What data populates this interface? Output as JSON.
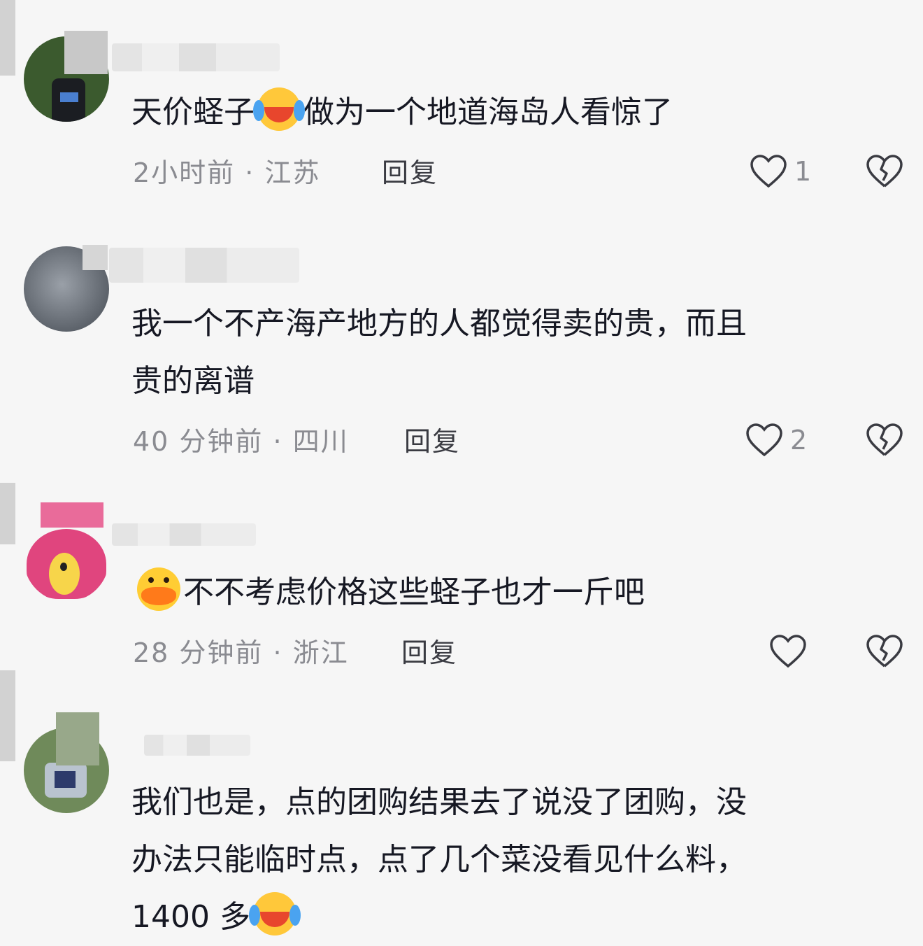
{
  "comments": [
    {
      "text_before": "天价蛏子",
      "emoji": "laughing-crying-emoji",
      "text_after": "做为一个地道海岛人看惊了",
      "time": "2小时前",
      "location": "江苏",
      "reply_label": "回复",
      "like_count": "1"
    },
    {
      "text_line1": "我一个不产海产地方的人都觉得卖的贵，而且",
      "text_line2": "贵的离谱",
      "time": "40 分钟前",
      "location": "四川",
      "reply_label": "回复",
      "like_count": "2"
    },
    {
      "emoji": "duck-quack-emoji",
      "text": "不不考虑价格这些蛏子也才一斤吧",
      "time": "28 分钟前",
      "location": "浙江",
      "reply_label": "回复",
      "like_count": ""
    },
    {
      "text_line1": "我们也是，点的团购结果去了说没了团购，没",
      "text_line2": "办法只能临时点，点了几个菜没看见什么料，",
      "text_line3": "1400 多",
      "emoji": "laughing-crying-emoji"
    }
  ],
  "colors": {
    "background": "#f6f6f6",
    "text": "#161823",
    "meta": "#8a8b91"
  }
}
